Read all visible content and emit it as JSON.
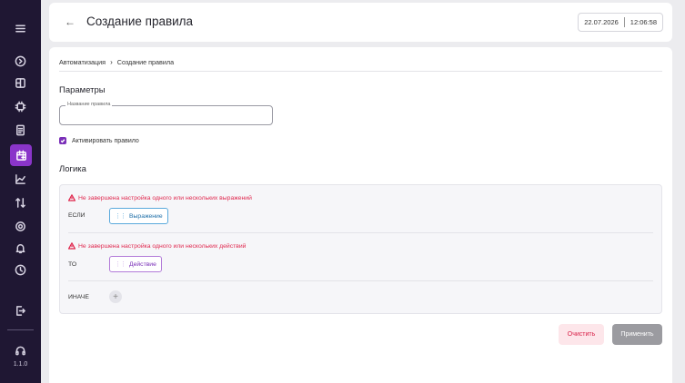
{
  "sidebar": {
    "items": [
      {
        "icon": "menu-icon"
      },
      {
        "icon": "play-circle-icon"
      },
      {
        "icon": "dashboard-icon"
      },
      {
        "icon": "chip-icon"
      },
      {
        "icon": "document-icon"
      },
      {
        "icon": "calendar-icon",
        "active": true
      },
      {
        "icon": "chart-icon"
      },
      {
        "icon": "exchange-icon"
      },
      {
        "icon": "gear-icon"
      },
      {
        "icon": "bell-icon"
      },
      {
        "icon": "clock-icon"
      },
      {
        "icon": "logout-icon"
      },
      {
        "icon": "headset-icon"
      }
    ],
    "version": "1.1.0",
    "active_color": "#8a35c9",
    "bg_color": "#1f1733"
  },
  "header": {
    "back_icon": "arrow-left-icon",
    "title": "Создание правила",
    "date": "22.07.2026",
    "time": "12:06:58"
  },
  "breadcrumb": {
    "parent": "Автоматизация",
    "current": "Создание правила"
  },
  "params": {
    "title": "Параметры",
    "name_field_label": "Название правила",
    "name_field_value": "",
    "activate_label": "Активировать правило",
    "activate_checked": true
  },
  "logic": {
    "title": "Логика",
    "if_warning": "Не завершена настройка одного или нескольких выражений",
    "if_label": "ЕСЛИ",
    "if_chip": "Выражение",
    "then_warning": "Не завершена настройка одного или нескольких действий",
    "then_label": "ТО",
    "then_chip": "Действие",
    "else_label": "ИНАЧЕ",
    "add_symbol": "+"
  },
  "actions": {
    "clear_label": "Очистить",
    "apply_label": "Применить"
  }
}
